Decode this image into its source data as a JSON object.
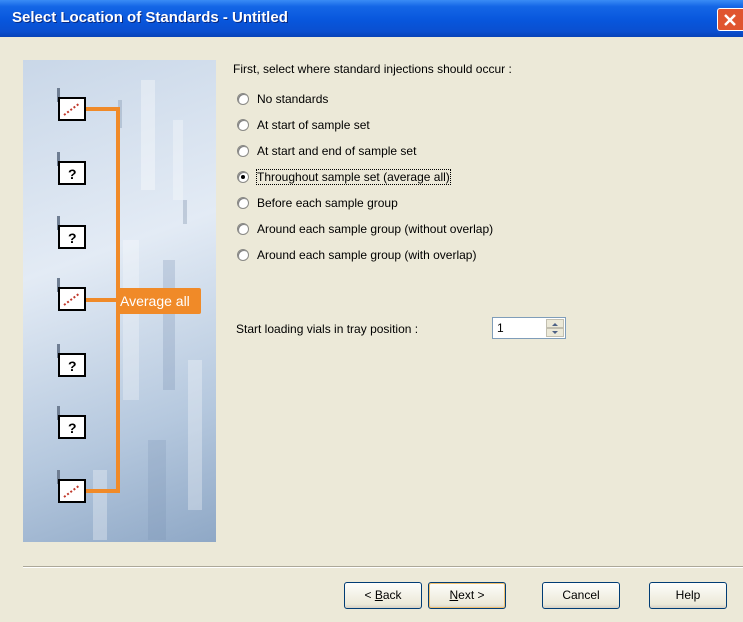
{
  "window": {
    "title": "Select Location of Standards - Untitled"
  },
  "illustration": {
    "callout_label": "Average all",
    "question_glyph": "?"
  },
  "main": {
    "prompt": "First, select where standard injections should occur :",
    "options": [
      {
        "label": "No standards",
        "checked": false
      },
      {
        "label": "At start of sample set",
        "checked": false
      },
      {
        "label": "At start and end of sample set",
        "checked": false
      },
      {
        "label": "Throughout sample set (average all)",
        "checked": true
      },
      {
        "label": "Before each sample group",
        "checked": false
      },
      {
        "label": "Around each sample group (without overlap)",
        "checked": false
      },
      {
        "label": "Around each sample group (with overlap)",
        "checked": false
      }
    ],
    "start_position": {
      "label": "Start loading vials in tray position :",
      "value": "1"
    }
  },
  "buttons": {
    "back": {
      "prefix": "< ",
      "mnemonic": "B",
      "rest": "ack"
    },
    "next": {
      "mnemonic": "N",
      "rest": "ext >"
    },
    "cancel": "Cancel",
    "help": "Help"
  },
  "colors": {
    "title_bar": "#0a56dc",
    "accent_orange": "#f08a28",
    "dialog_bg": "#ece9d8"
  }
}
